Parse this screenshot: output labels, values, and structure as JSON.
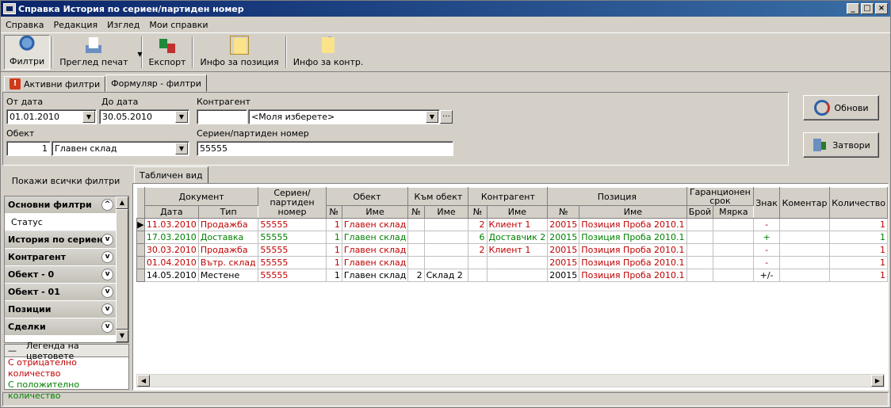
{
  "window": {
    "title": "Справка История по сериен/партиден номер"
  },
  "title_buttons": {
    "minimize": "_",
    "maximize": "□",
    "close": "×"
  },
  "menu": [
    "Справка",
    "Редакция",
    "Изглед",
    "Мои справки"
  ],
  "toolbar": {
    "filters": "Филтри",
    "print_preview": "Преглед печат",
    "export": "Експорт",
    "info_position": "Инфо за позиция",
    "info_contr": "Инфо за контр."
  },
  "tabs": {
    "active_filters": "Активни филтри",
    "form_filters": "Формуляр - филтри"
  },
  "filters": {
    "from_date_label": "От дата",
    "from_date": "01.01.2010",
    "to_date_label": "До дата",
    "to_date": "30.05.2010",
    "contragent_label": "Контрагент",
    "contragent_code": "",
    "contragent_value": "<Моля изберете>",
    "object_label": "Обект",
    "object_num": "1",
    "object_name": "Главен склад",
    "serial_label": "Сериен/партиден номер",
    "serial_value": "55555"
  },
  "buttons": {
    "refresh": "Обнови",
    "close": "Затвори"
  },
  "left": {
    "show_all": "Покажи всички филтри",
    "sections": [
      {
        "label": "Основни филтри",
        "expanded": true,
        "sub": "Статус"
      },
      {
        "label": "История по сериен..."
      },
      {
        "label": "Контрагент"
      },
      {
        "label": "Обект - 0"
      },
      {
        "label": "Обект - 01"
      },
      {
        "label": "Позиции"
      },
      {
        "label": "Сделки"
      }
    ],
    "legend_dash": "—",
    "legend_title": "Легенда на цветовете",
    "legend_neg": "С отрицателно количество",
    "legend_pos": "С положително количество"
  },
  "grid_tab": "Табличен вид",
  "grid": {
    "headers_top": {
      "document": "Документ",
      "serial": "Сериен/партиден номер",
      "object": "Обект",
      "to_object": "Към обект",
      "contragent": "Контрагент",
      "position": "Позиция",
      "warranty": "Гаранционен срок",
      "sign": "Знак",
      "comment": "Коментар",
      "qty": "Количество"
    },
    "headers_sub": {
      "date": "Дата",
      "type": "Тип",
      "obj_no": "№",
      "obj_name": "Име",
      "to_no": "№",
      "to_name": "Име",
      "c_no": "№",
      "c_name": "Име",
      "p_no": "№",
      "p_name": "Име",
      "w_count": "Брой",
      "w_unit": "Мярка"
    },
    "rows": [
      {
        "ind": "▶",
        "date": "11.03.2010",
        "type": "Продажба",
        "serial": "55555",
        "obj_no": "1",
        "obj_name": "Главен склад",
        "to_no": "",
        "to_name": "",
        "c_no": "2",
        "c_name": "Клиент 1",
        "p_no": "20015",
        "p_name": "Позиция Проба 2010.1",
        "w_count": "",
        "w_unit": "",
        "sign": "-",
        "comment": "",
        "qty": "1"
      },
      {
        "ind": "",
        "date": "17.03.2010",
        "type": "Доставка",
        "serial": "55555",
        "obj_no": "1",
        "obj_name": "Главен склад",
        "to_no": "",
        "to_name": "",
        "c_no": "6",
        "c_name": "Доставчик 2",
        "p_no": "20015",
        "p_name": "Позиция Проба 2010.1",
        "w_count": "",
        "w_unit": "",
        "sign": "+",
        "comment": "",
        "qty": "1"
      },
      {
        "ind": "",
        "date": "30.03.2010",
        "type": "Продажба",
        "serial": "55555",
        "obj_no": "1",
        "obj_name": "Главен склад",
        "to_no": "",
        "to_name": "",
        "c_no": "2",
        "c_name": "Клиент 1",
        "p_no": "20015",
        "p_name": "Позиция Проба 2010.1",
        "w_count": "",
        "w_unit": "",
        "sign": "-",
        "comment": "",
        "qty": "1"
      },
      {
        "ind": "",
        "date": "01.04.2010",
        "type": "Вътр. склад",
        "serial": "55555",
        "obj_no": "1",
        "obj_name": "Главен склад",
        "to_no": "",
        "to_name": "",
        "c_no": "",
        "c_name": "",
        "p_no": "20015",
        "p_name": "Позиция Проба 2010.1",
        "w_count": "",
        "w_unit": "",
        "sign": "-",
        "comment": "",
        "qty": "1"
      },
      {
        "ind": "",
        "date": "14.05.2010",
        "type": "Местене",
        "serial": "55555",
        "obj_no": "1",
        "obj_name": "Главен склад",
        "to_no": "2",
        "to_name": "Склад 2",
        "c_no": "",
        "c_name": "",
        "p_no": "20015",
        "p_name": "Позиция Проба 2010.1",
        "w_count": "",
        "w_unit": "",
        "sign": "+/-",
        "comment": "",
        "qty": "1"
      }
    ],
    "row_colors": [
      "neg",
      "pos",
      "neg",
      "neg",
      "mix"
    ]
  }
}
